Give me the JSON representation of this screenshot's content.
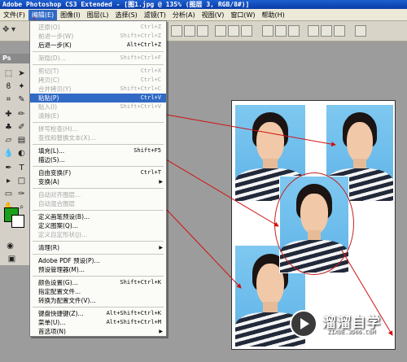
{
  "title_bar": {
    "text": "Adobe Photoshop CS3 Extended - [图1.jpg @ 135% (图层 3, RGB/8#)]"
  },
  "menu_bar": {
    "items": [
      {
        "label": "文件(F)"
      },
      {
        "label": "编辑(E)",
        "active": true
      },
      {
        "label": "图像(I)"
      },
      {
        "label": "图层(L)"
      },
      {
        "label": "选择(S)"
      },
      {
        "label": "滤镜(T)"
      },
      {
        "label": "分析(A)"
      },
      {
        "label": "视图(V)"
      },
      {
        "label": "窗口(W)"
      },
      {
        "label": "帮助(H)"
      }
    ]
  },
  "tool_panel": {
    "label": "Ps",
    "foreground_color": "#1aa01a",
    "background_color": "#ffffff"
  },
  "edit_menu": {
    "items": [
      {
        "label": "还原(O)",
        "shortcut": "Ctrl+Z",
        "disabled": true
      },
      {
        "label": "前进一步(W)",
        "shortcut": "Shift+Ctrl+Z",
        "disabled": true
      },
      {
        "label": "后退一步(K)",
        "shortcut": "Alt+Ctrl+Z",
        "disabled": false
      },
      {
        "label": "渐隐(D)...",
        "shortcut": "Shift+Ctrl+F",
        "disabled": true
      },
      {
        "label": "剪切(T)",
        "shortcut": "Ctrl+X",
        "disabled": true
      },
      {
        "label": "拷贝(C)",
        "shortcut": "Ctrl+C",
        "disabled": true
      },
      {
        "label": "合并拷贝(Y)",
        "shortcut": "Shift+Ctrl+C",
        "disabled": true
      },
      {
        "label": "粘贴(P)",
        "shortcut": "Ctrl+V",
        "disabled": false,
        "highlighted": true
      },
      {
        "label": "贴入(I)",
        "shortcut": "Shift+Ctrl+V",
        "disabled": true
      },
      {
        "label": "清除(E)",
        "shortcut": "",
        "disabled": true
      },
      {
        "label": "拼写检查(H)...",
        "shortcut": "",
        "disabled": true
      },
      {
        "label": "查找和替换文本(X)...",
        "shortcut": "",
        "disabled": true
      },
      {
        "label": "填充(L)...",
        "shortcut": "Shift+F5",
        "disabled": false
      },
      {
        "label": "描边(S)...",
        "shortcut": "",
        "disabled": false
      },
      {
        "label": "自由变换(F)",
        "shortcut": "Ctrl+T",
        "disabled": false
      },
      {
        "label": "变换(A)",
        "shortcut": "",
        "disabled": false,
        "submenu": true
      },
      {
        "label": "自动对齐图层...",
        "shortcut": "",
        "disabled": true
      },
      {
        "label": "自动混合图层",
        "shortcut": "",
        "disabled": true
      },
      {
        "label": "定义画笔预设(B)...",
        "shortcut": "",
        "disabled": false
      },
      {
        "label": "定义图案(Q)...",
        "shortcut": "",
        "disabled": false
      },
      {
        "label": "定义自定形状(J)...",
        "shortcut": "",
        "disabled": true
      },
      {
        "label": "清理(R)",
        "shortcut": "",
        "disabled": false,
        "submenu": true
      },
      {
        "label": "Adobe PDF 预设(P)...",
        "shortcut": "",
        "disabled": false
      },
      {
        "label": "预设管理器(M)...",
        "shortcut": "",
        "disabled": false
      },
      {
        "label": "颜色设置(G)...",
        "shortcut": "Shift+Ctrl+K",
        "disabled": false
      },
      {
        "label": "指定配置文件...",
        "shortcut": "",
        "disabled": false
      },
      {
        "label": "转换为配置文件(V)...",
        "shortcut": "",
        "disabled": false
      },
      {
        "label": "键盘快捷键(Z)...",
        "shortcut": "Alt+Shift+Ctrl+K",
        "disabled": false
      },
      {
        "label": "菜单(U)...",
        "shortcut": "Alt+Shift+Ctrl+M",
        "disabled": false
      },
      {
        "label": "首选项(N)",
        "shortcut": "",
        "disabled": false,
        "submenu": true
      }
    ]
  },
  "watermark": {
    "title": "溜溜自学",
    "subtitle": "ZIXUE.3D66.COM"
  }
}
